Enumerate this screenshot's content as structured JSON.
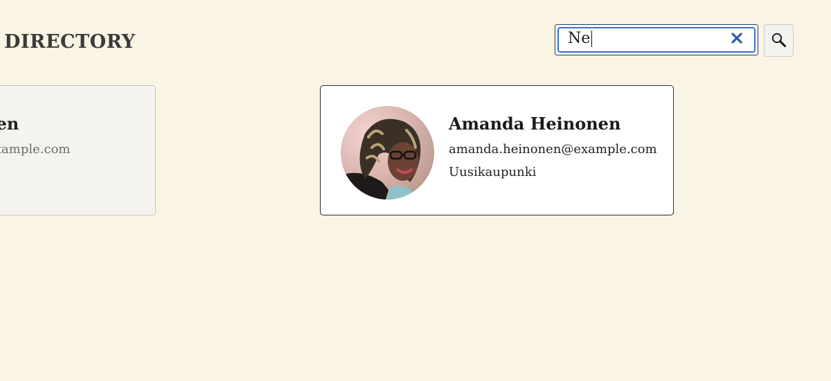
{
  "header": {
    "title": "DIRECTORY"
  },
  "search": {
    "value": "Ne",
    "clear_icon": "close-icon",
    "button_icon": "magnifier-icon",
    "accent_color": "#3a6fc8",
    "clear_color": "#2f5aa8"
  },
  "cards": [
    {
      "name": "ltonen",
      "email": "en@example.com",
      "partially_visible": true
    },
    {
      "name": "Amanda Heinonen",
      "email": "amanda.heinonen@example.com",
      "city": "Uusikaupunki",
      "avatar_icon": "user-photo"
    }
  ],
  "colors": {
    "background": "#faf4e4",
    "card_border": "#2a2a2a"
  }
}
